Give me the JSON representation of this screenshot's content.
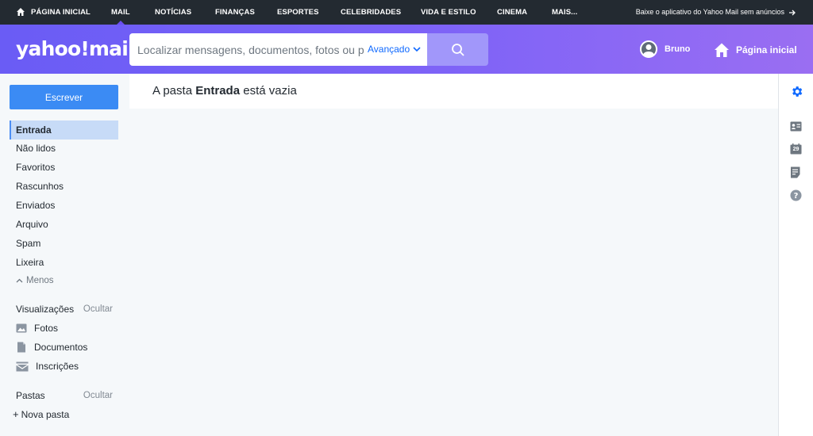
{
  "topnav": {
    "items": [
      "PÁGINA INICIAL",
      "MAIL",
      "NOTÍCIAS",
      "FINANÇAS",
      "ESPORTES",
      "CELEBRIDADES",
      "VIDA E ESTILO",
      "CINEMA",
      "MAIS..."
    ],
    "active": "MAIL",
    "promo": "Baixe o aplicativo do Yahoo Mail sem anúncios"
  },
  "header": {
    "logo": "yahoo!mail",
    "search_placeholder": "Localizar mensagens, documentos, fotos ou pes",
    "advanced": "Avançado",
    "user_name": "Bruno",
    "home_label": "Página inicial"
  },
  "sidebar": {
    "compose": "Escrever",
    "folders": [
      "Entrada",
      "Não lidos",
      "Favoritos",
      "Rascunhos",
      "Enviados",
      "Arquivo",
      "Spam",
      "Lixeira"
    ],
    "active_folder": "Entrada",
    "less": "Menos",
    "views_title": "Visualizações",
    "views_hide": "Ocultar",
    "views": [
      "Fotos",
      "Documentos",
      "Inscrições"
    ],
    "folders_title": "Pastas",
    "folders_hide": "Ocultar",
    "new_folder": "Nova pasta"
  },
  "main": {
    "title_prefix": "A pasta",
    "title_folder": "Entrada",
    "title_suffix": "está vazia"
  },
  "rail": {
    "calendar_day": "29"
  },
  "colors": {
    "topnav": "#232a31",
    "header_gradient_start": "#6a5cf5",
    "header_gradient_end": "#9a6ef2",
    "compose": "#3b8bf4",
    "active_folder": "#c7dbf7",
    "settings_icon": "#0f69ff"
  },
  "icons": [
    "home-icon",
    "arrow-right-icon",
    "chevron-down-icon",
    "search-icon",
    "user-avatar-icon",
    "house-icon",
    "chevron-up-icon",
    "photos-icon",
    "documents-icon",
    "subscriptions-icon",
    "gear-icon",
    "contacts-icon",
    "calendar-icon",
    "notepad-icon",
    "help-icon"
  ]
}
